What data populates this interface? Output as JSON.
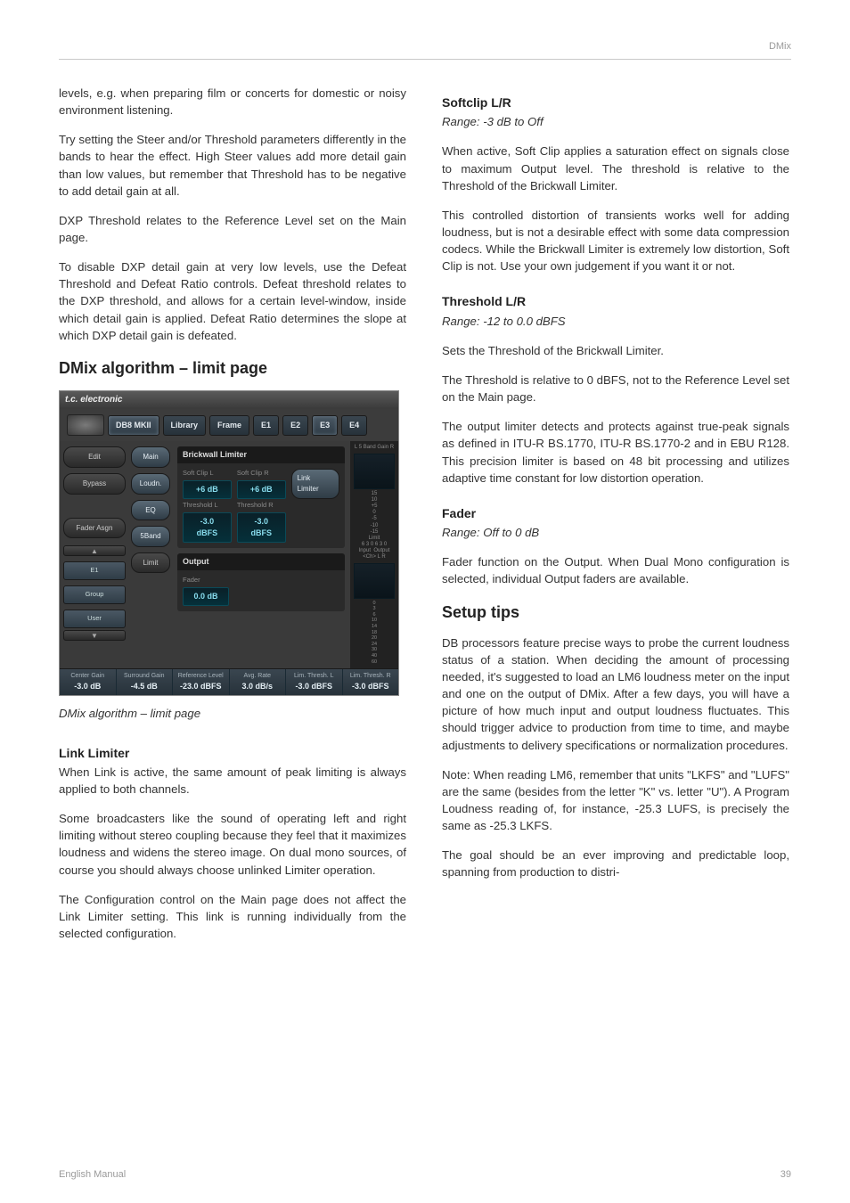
{
  "header": {
    "breadcrumb": "DMix"
  },
  "footer": {
    "left": "English Manual",
    "right": "39"
  },
  "left": {
    "p1": "levels, e.g. when preparing film or concerts for domestic or noisy environment listening.",
    "p2": "Try setting the Steer and/or Threshold parameters differently in the bands to hear the effect. High Steer values add more detail gain than low values, but remember that Threshold has to be negative to add detail gain at all.",
    "p3": "DXP Threshold relates to the Reference Level set on the Main page.",
    "p4": "To disable DXP detail gain at very low levels, use the Defeat Threshold and Defeat Ratio controls. Defeat threshold relates to the DXP threshold, and allows for a certain level-window, inside which detail gain is applied. Defeat Ratio determines the slope at which DXP detail gain is defeated.",
    "h2a": "DMix algorithm – limit page",
    "caption": "DMix algorithm – limit page",
    "h3a": "Link Limiter",
    "p5": "When Link is active, the same amount of peak limiting is always applied to both channels.",
    "p6": "Some broadcasters like the sound of operating left and right limiting without stereo coupling because they feel that it maximizes loudness and widens the stereo image. On dual mono sources, of course you should always choose unlinked Limiter operation.",
    "p7": "The Configuration control on the Main page does not affect the Link Limiter setting. This link is running individually from the selected configuration."
  },
  "right": {
    "h3a": "Softclip L/R",
    "r1": "Range: -3 dB to Off",
    "p1": "When active, Soft Clip applies a saturation effect on signals close to maximum Output level. The threshold is relative to the Threshold of the Brickwall Limiter.",
    "p2": "This controlled distortion of transients works well for adding loudness, but is not a desirable effect with some data compression codecs. While the Brickwall Limiter is extremely low distortion, Soft Clip is not. Use your own judgement if you want it or not.",
    "h3b": "Threshold L/R",
    "r2": "Range: -12 to 0.0 dBFS",
    "p3": "Sets the Threshold of the Brickwall Limiter.",
    "p4": "The Threshold is relative to 0 dBFS, not to the Reference Level set on the Main page.",
    "p5": "The output limiter detects and protects against true-peak signals as defined in ITU-R BS.1770, ITU-R BS.1770-2 and in EBU R128. This precision limiter is based on 48 bit processing and utilizes adaptive time constant for low distortion operation.",
    "h3c": "Fader",
    "r3": "Range: Off to 0 dB",
    "p6": "Fader function on the Output. When Dual Mono configuration is selected, individual Output faders are available.",
    "h2b": "Setup tips",
    "p7": "DB processors feature precise ways to probe the current loudness status of a station. When deciding the amount of processing needed, it's suggested to load an LM6 loudness meter on the input and one on the output of DMix. After a few days, you will have a picture of how much input and output loudness fluctuates. This should trigger advice to production from time to time, and maybe adjustments to delivery specifications or normalization procedures.",
    "p8": "Note: When reading LM6, remember that units \"LKFS\" and \"LUFS\" are the same (besides from the letter \"K\" vs. letter \"U\"). A Program Loudness reading of, for instance, -25.3 LUFS, is precisely the same as -25.3 LKFS.",
    "p9": "The goal should be an ever improving and predictable loop, spanning from production to distri-"
  },
  "shot": {
    "brand": "t.c. electronic",
    "tabs": {
      "db8": "DB8 MKII",
      "library": "Library",
      "frame": "Frame",
      "e1": "E1",
      "e2": "E2",
      "e3": "E3",
      "e4": "E4"
    },
    "side": {
      "edit": "Edit",
      "bypass": "Bypass",
      "fader": "Fader Asgn",
      "main": "Main",
      "loudn": "Loudn.",
      "eq": "EQ",
      "fiveband": "5Band",
      "limit": "Limit",
      "e1": "E1",
      "group": "Group",
      "user": "User"
    },
    "brickwall": {
      "title": "Brickwall Limiter",
      "softclip_l_lbl": "Soft Clip L",
      "softclip_l_val": "+6 dB",
      "softclip_r_lbl": "Soft Clip R",
      "softclip_r_val": "+6 dB",
      "thr_l_lbl": "Threshold L",
      "thr_l_val": "-3.0 dBFS",
      "thr_r_lbl": "Threshold R",
      "thr_r_val": "-3.0 dBFS",
      "link": "Link Limiter"
    },
    "output": {
      "title": "Output",
      "fader_lbl": "Fader",
      "fader_val": "0.0 dB"
    },
    "meters": {
      "hdr": "L   5 Band Gain   R",
      "scale1": "15\n10\n+5\n0\n-5\n-10\n-15",
      "limit": "Limit",
      "scale2": "6 3 0     6 3 0",
      "in": "Input",
      "out": "Output",
      "lr": "<Ch>   L         R",
      "scale3": "0\n3\n6\n10\n14\n18\n20\n24\n30\n40\n60"
    },
    "status": {
      "c1l": "Center Gain",
      "c1v": "-3.0 dB",
      "c2l": "Surround Gain",
      "c2v": "-4.5 dB",
      "c3l": "Reference Level",
      "c3v": "-23.0 dBFS",
      "c4l": "Avg. Rate",
      "c4v": "3.0 dB/s",
      "c5l": "Lim. Thresh. L",
      "c5v": "-3.0 dBFS",
      "c6l": "Lim. Thresh. R",
      "c6v": "-3.0 dBFS"
    }
  }
}
